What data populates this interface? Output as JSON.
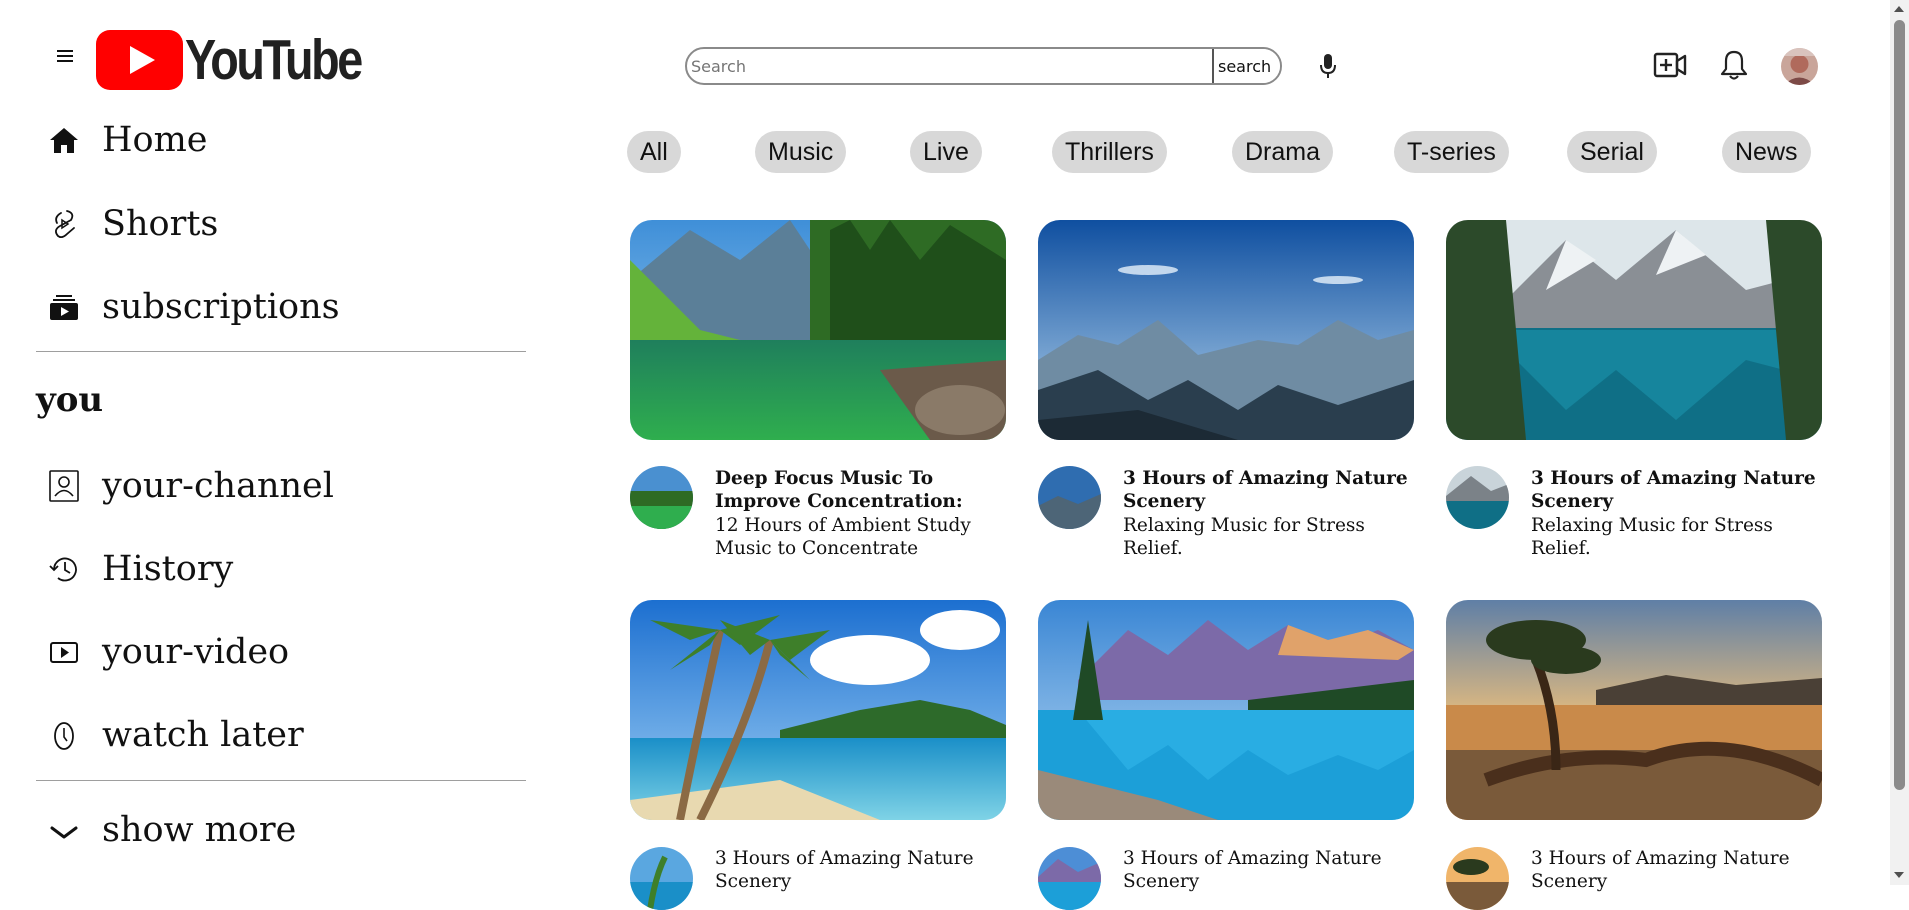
{
  "header": {
    "logo_text": "YouTube",
    "search_placeholder": "Search",
    "search_button_label": "search",
    "colors": {
      "brand_red": "#FF0000",
      "chip_bg": "#D8D8D8"
    }
  },
  "sidebar": {
    "main_items": [
      {
        "label": "Home",
        "icon": "home-icon"
      },
      {
        "label": "Shorts",
        "icon": "shorts-icon"
      },
      {
        "label": "subscriptions",
        "icon": "subscriptions-icon"
      }
    ],
    "you_heading": "you",
    "you_items": [
      {
        "label": "your-channel",
        "icon": "channel-icon"
      },
      {
        "label": "History",
        "icon": "history-icon"
      },
      {
        "label": "your-video",
        "icon": "video-icon"
      },
      {
        "label": "watch later",
        "icon": "clock-icon"
      }
    ],
    "show_more_label": "show more"
  },
  "chips": [
    "All",
    "Music",
    "Live",
    "Thrillers",
    "Drama",
    "T-series",
    "Serial",
    "News"
  ],
  "videos": [
    {
      "title": "Deep Focus Music To Improve Concentration:",
      "subtitle": "12 Hours of Ambient Study Music to Concentrate",
      "thumbnail": "green-lake-forest"
    },
    {
      "title": "3 Hours of Amazing Nature Scenery",
      "subtitle": "Relaxing Music for Stress Relief.",
      "thumbnail": "mountain-valley-sky"
    },
    {
      "title": "3 Hours of Amazing Nature Scenery",
      "subtitle": "Relaxing Music for Stress Relief.",
      "thumbnail": "alpine-lake-reflection"
    },
    {
      "title": "3 Hours of Amazing Nature Scenery",
      "subtitle": "",
      "thumbnail": "tropical-beach-palms"
    },
    {
      "title": "3 Hours of Amazing Nature Scenery",
      "subtitle": "",
      "thumbnail": "turquoise-mountain-lake"
    },
    {
      "title": "3 Hours of Amazing Nature Scenery",
      "subtitle": "",
      "thumbnail": "sunset-lake-tree"
    }
  ]
}
